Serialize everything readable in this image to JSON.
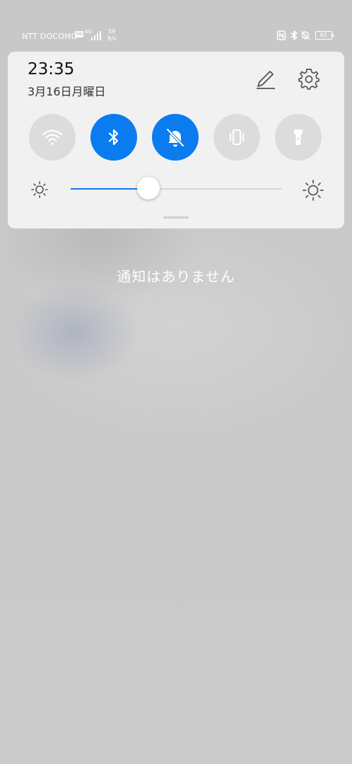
{
  "status_bar": {
    "carrier": "NTT DOCOMO",
    "hd_badge": "HD",
    "network_type": "4G",
    "speed_value": "59",
    "speed_unit": "B/s",
    "battery": "61",
    "icons": [
      "nfc-icon",
      "bluetooth-icon",
      "mute-icon",
      "battery-icon"
    ]
  },
  "panel": {
    "time": "23:35",
    "date": "3月16日月曜日",
    "edit_icon": "pencil-icon",
    "settings_icon": "gear-icon",
    "tiles": [
      {
        "icon": "wifi-icon",
        "state": "off"
      },
      {
        "icon": "bluetooth-icon",
        "state": "on"
      },
      {
        "icon": "silent-bell-icon",
        "state": "on"
      },
      {
        "icon": "vibrate-icon",
        "state": "off"
      },
      {
        "icon": "flashlight-icon",
        "state": "off"
      }
    ],
    "brightness_level_percent": 37
  },
  "notifications": {
    "empty_text": "通知はありません"
  },
  "colors": {
    "accent": "#0a7cf0",
    "tile_off": "#dcdcdc",
    "panel_bg": "#f1f1f1"
  }
}
